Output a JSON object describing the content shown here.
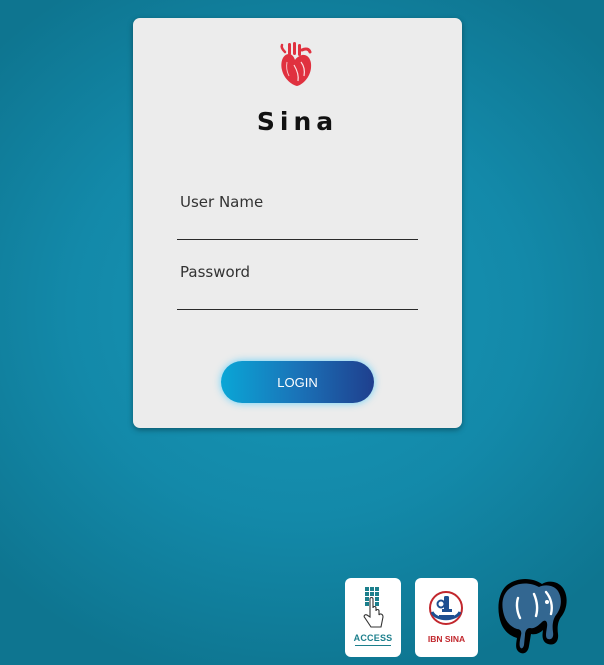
{
  "app": {
    "title": "Sina"
  },
  "form": {
    "username_label": "User Name",
    "username_value": "",
    "password_label": "Password",
    "password_value": "",
    "login_label": "LOGIN"
  },
  "logos": {
    "access": {
      "name": "access-logo",
      "text": "ACCESS"
    },
    "ibn_sina": {
      "name": "ibn-sina-logo",
      "text": "IBN SINA"
    },
    "postgres": {
      "name": "postgresql-elephant-logo"
    }
  },
  "colors": {
    "background": "#1389a9",
    "card": "#ececec",
    "heart": "#e0313f",
    "button_start": "#0aa6d6",
    "button_end": "#1f3f8e"
  }
}
